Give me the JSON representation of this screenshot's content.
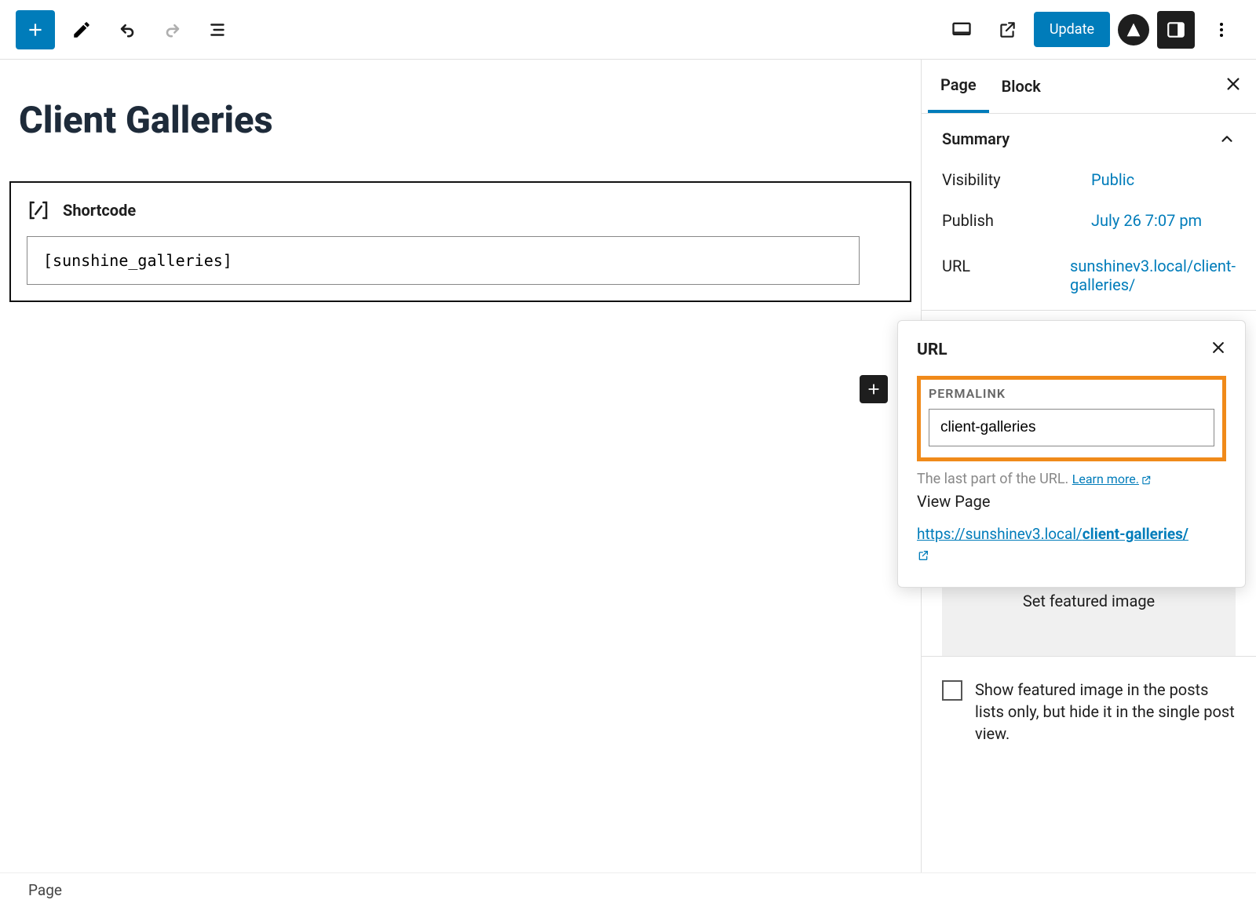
{
  "toolbar": {
    "update_label": "Update",
    "avatar_letter": "A"
  },
  "page": {
    "title": "Client Galleries",
    "shortcode_label": "Shortcode",
    "shortcode_value": "[sunshine_galleries]"
  },
  "sidebar": {
    "tabs": {
      "page": "Page",
      "block": "Block"
    },
    "summary": {
      "title": "Summary",
      "visibility_label": "Visibility",
      "visibility_value": "Public",
      "publish_label": "Publish",
      "publish_value": "July 26 7:07 pm",
      "url_label": "URL",
      "url_value": "sunshinev3.local/client-galleries/"
    },
    "featured_image": {
      "button": "Set featured image",
      "checkbox_text": "Show featured image in the posts lists only, but hide it in the single post view."
    }
  },
  "popover": {
    "title": "URL",
    "permalink_label": "PERMALINK",
    "permalink_value": "client-galleries",
    "helper_text": "The last part of the URL. ",
    "learn_more": "Learn more.",
    "view_page": "View Page",
    "full_url_prefix": "https://sunshinev3.local/",
    "full_url_slug": "client-galleries/"
  },
  "breadcrumb": "Page"
}
